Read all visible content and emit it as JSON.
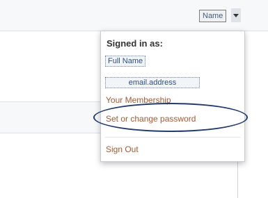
{
  "header": {
    "user_button_label": "Name"
  },
  "account_menu": {
    "signed_in_label": "Signed in as:",
    "full_name": "Full Name",
    "email": "email.address",
    "membership_link": "Your Membership",
    "password_link": "Set or change password",
    "sign_out_link": "Sign Out"
  },
  "colors": {
    "link": "#a55a33",
    "highlight_oval": "#223b6b"
  },
  "icons": {
    "dropdown": "caret-down-icon"
  }
}
